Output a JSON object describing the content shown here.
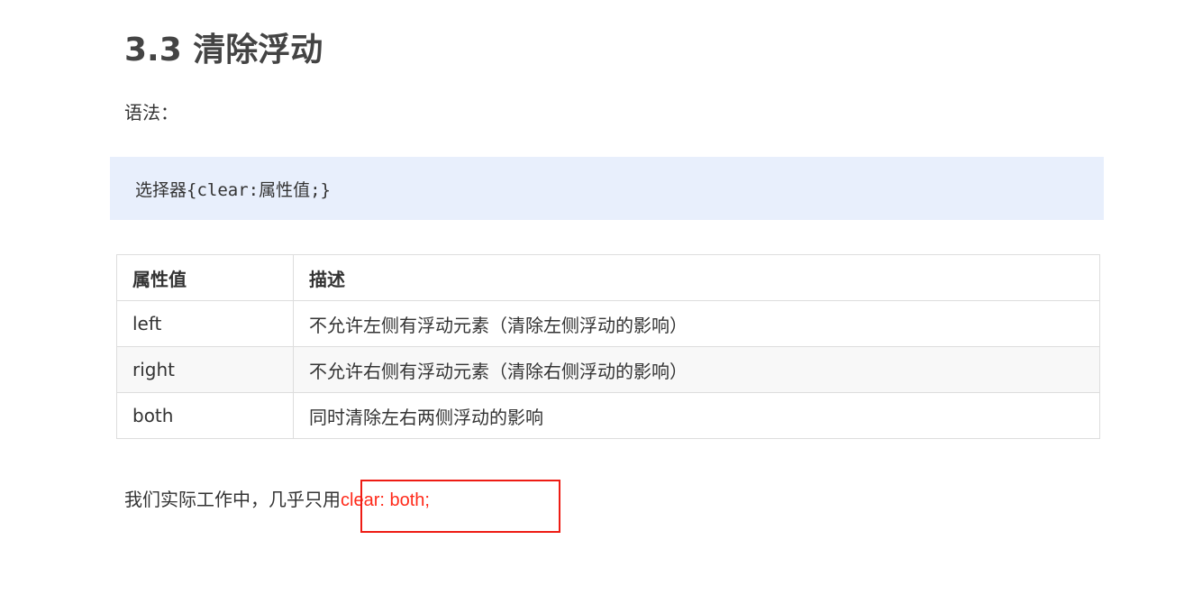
{
  "heading": {
    "title": "3.3 清除浮动"
  },
  "syntax": {
    "label": "语法：",
    "code": "选择器{clear:属性值;}"
  },
  "table": {
    "headers": [
      "属性值",
      "描述"
    ],
    "rows": [
      [
        "left",
        "不允许左侧有浮动元素（清除左侧浮动的影响）"
      ],
      [
        "right",
        "不允许右侧有浮动元素（清除右侧浮动的影响）"
      ],
      [
        "both",
        "同时清除左右两侧浮动的影响"
      ]
    ]
  },
  "note": {
    "text": "我们实际工作中，几乎只用",
    "highlight": "clear: both;"
  },
  "colors": {
    "code_background": "#e8effc",
    "highlight_text": "#ff2a1a",
    "annotation_border": "#ee1c14"
  }
}
